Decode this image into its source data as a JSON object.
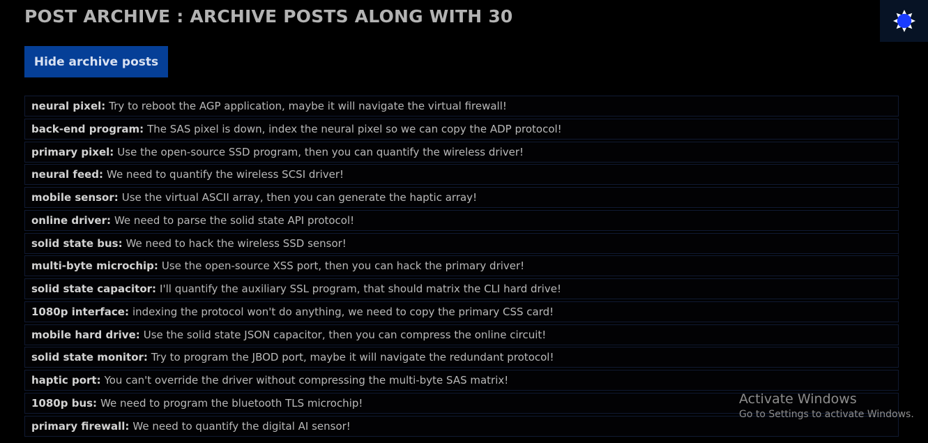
{
  "header": {
    "title": "POST ARCHIVE : ARCHIVE POSTS ALONG WITH 30"
  },
  "controls": {
    "hide_archive_label": "Hide archive posts",
    "theme_icon": "sun-badge-icon",
    "theme_icon_color": "#1a3cff"
  },
  "colors": {
    "background": "#000000",
    "button_bg": "#053f97",
    "toggle_bg": "#071325",
    "row_border": "#101a33"
  },
  "posts": [
    {
      "author": "neural pixel:",
      "message": "Try to reboot the AGP application, maybe it will navigate the virtual firewall!"
    },
    {
      "author": "back-end program:",
      "message": "The SAS pixel is down, index the neural pixel so we can copy the ADP protocol!"
    },
    {
      "author": "primary pixel:",
      "message": "Use the open-source SSD program, then you can quantify the wireless driver!"
    },
    {
      "author": "neural feed:",
      "message": "We need to quantify the wireless SCSI driver!"
    },
    {
      "author": "mobile sensor:",
      "message": "Use the virtual ASCII array, then you can generate the haptic array!"
    },
    {
      "author": "online driver:",
      "message": "We need to parse the solid state API protocol!"
    },
    {
      "author": "solid state bus:",
      "message": "We need to hack the wireless SSD sensor!"
    },
    {
      "author": "multi-byte microchip:",
      "message": "Use the open-source XSS port, then you can hack the primary driver!"
    },
    {
      "author": "solid state capacitor:",
      "message": "I'll quantify the auxiliary SSL program, that should matrix the CLI hard drive!"
    },
    {
      "author": "1080p interface:",
      "message": "indexing the protocol won't do anything, we need to copy the primary CSS card!"
    },
    {
      "author": "mobile hard drive:",
      "message": "Use the solid state JSON capacitor, then you can compress the online circuit!"
    },
    {
      "author": "solid state monitor:",
      "message": "Try to program the JBOD port, maybe it will navigate the redundant protocol!"
    },
    {
      "author": "haptic port:",
      "message": "You can't override the driver without compressing the multi-byte SAS matrix!"
    },
    {
      "author": "1080p bus:",
      "message": "We need to program the bluetooth TLS microchip!"
    },
    {
      "author": "primary firewall:",
      "message": "We need to quantify the digital AI sensor!"
    }
  ],
  "overlay": {
    "activate_title": "Activate Windows",
    "activate_sub": "Go to Settings to activate Windows."
  }
}
